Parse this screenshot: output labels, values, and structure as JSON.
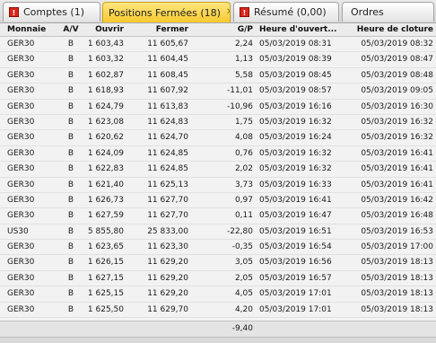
{
  "tabs": [
    {
      "label": "Comptes (1)",
      "alert": "!",
      "active": false
    },
    {
      "label": "Positions Fermées (18)",
      "close": "✕",
      "active": true
    },
    {
      "label": "Résumé (0,00)",
      "alert": "!",
      "active": false
    },
    {
      "label": "Ordres",
      "active": false
    }
  ],
  "columns": {
    "monnaie": "Monnaie",
    "av": "A/V",
    "ouvrir": "Ouvrir",
    "fermer": "Fermer",
    "gp": "G/P",
    "heure_ouverture": "Heure d'ouvert...",
    "heure_cloture": "Heure de cloture"
  },
  "rows": [
    {
      "monnaie": "GER30",
      "av": "B",
      "ouvrir": "1 603,43",
      "fermer": "11 605,67",
      "gp": "2,24",
      "heure_ouverture": "05/03/2019 08:31",
      "heure_cloture": "05/03/2019 08:32"
    },
    {
      "monnaie": "GER30",
      "av": "B",
      "ouvrir": "1 603,32",
      "fermer": "11 604,45",
      "gp": "1,13",
      "heure_ouverture": "05/03/2019 08:39",
      "heure_cloture": "05/03/2019 08:47"
    },
    {
      "monnaie": "GER30",
      "av": "B",
      "ouvrir": "1 602,87",
      "fermer": "11 608,45",
      "gp": "5,58",
      "heure_ouverture": "05/03/2019 08:45",
      "heure_cloture": "05/03/2019 08:48"
    },
    {
      "monnaie": "GER30",
      "av": "B",
      "ouvrir": "1 618,93",
      "fermer": "11 607,92",
      "gp": "-11,01",
      "heure_ouverture": "05/03/2019 08:57",
      "heure_cloture": "05/03/2019 09:05"
    },
    {
      "monnaie": "GER30",
      "av": "B",
      "ouvrir": "1 624,79",
      "fermer": "11 613,83",
      "gp": "-10,96",
      "heure_ouverture": "05/03/2019 16:16",
      "heure_cloture": "05/03/2019 16:30"
    },
    {
      "monnaie": "GER30",
      "av": "B",
      "ouvrir": "1 623,08",
      "fermer": "11 624,83",
      "gp": "1,75",
      "heure_ouverture": "05/03/2019 16:32",
      "heure_cloture": "05/03/2019 16:32"
    },
    {
      "monnaie": "GER30",
      "av": "B",
      "ouvrir": "1 620,62",
      "fermer": "11 624,70",
      "gp": "4,08",
      "heure_ouverture": "05/03/2019 16:24",
      "heure_cloture": "05/03/2019 16:32"
    },
    {
      "monnaie": "GER30",
      "av": "B",
      "ouvrir": "1 624,09",
      "fermer": "11 624,85",
      "gp": "0,76",
      "heure_ouverture": "05/03/2019 16:32",
      "heure_cloture": "05/03/2019 16:41"
    },
    {
      "monnaie": "GER30",
      "av": "B",
      "ouvrir": "1 622,83",
      "fermer": "11 624,85",
      "gp": "2,02",
      "heure_ouverture": "05/03/2019 16:32",
      "heure_cloture": "05/03/2019 16:41"
    },
    {
      "monnaie": "GER30",
      "av": "B",
      "ouvrir": "1 621,40",
      "fermer": "11 625,13",
      "gp": "3,73",
      "heure_ouverture": "05/03/2019 16:33",
      "heure_cloture": "05/03/2019 16:41"
    },
    {
      "monnaie": "GER30",
      "av": "B",
      "ouvrir": "1 626,73",
      "fermer": "11 627,70",
      "gp": "0,97",
      "heure_ouverture": "05/03/2019 16:41",
      "heure_cloture": "05/03/2019 16:42"
    },
    {
      "monnaie": "GER30",
      "av": "B",
      "ouvrir": "1 627,59",
      "fermer": "11 627,70",
      "gp": "0,11",
      "heure_ouverture": "05/03/2019 16:47",
      "heure_cloture": "05/03/2019 16:48"
    },
    {
      "monnaie": "US30",
      "av": "B",
      "ouvrir": "5 855,80",
      "fermer": "25 833,00",
      "gp": "-22,80",
      "heure_ouverture": "05/03/2019 16:51",
      "heure_cloture": "05/03/2019 16:53"
    },
    {
      "monnaie": "GER30",
      "av": "B",
      "ouvrir": "1 623,65",
      "fermer": "11 623,30",
      "gp": "-0,35",
      "heure_ouverture": "05/03/2019 16:54",
      "heure_cloture": "05/03/2019 17:00"
    },
    {
      "monnaie": "GER30",
      "av": "B",
      "ouvrir": "1 626,15",
      "fermer": "11 629,20",
      "gp": "3,05",
      "heure_ouverture": "05/03/2019 16:56",
      "heure_cloture": "05/03/2019 18:13"
    },
    {
      "monnaie": "GER30",
      "av": "B",
      "ouvrir": "1 627,15",
      "fermer": "11 629,20",
      "gp": "2,05",
      "heure_ouverture": "05/03/2019 16:57",
      "heure_cloture": "05/03/2019 18:13"
    },
    {
      "monnaie": "GER30",
      "av": "B",
      "ouvrir": "1 625,15",
      "fermer": "11 629,20",
      "gp": "4,05",
      "heure_ouverture": "05/03/2019 17:01",
      "heure_cloture": "05/03/2019 18:13"
    },
    {
      "monnaie": "GER30",
      "av": "B",
      "ouvrir": "1 625,50",
      "fermer": "11 629,70",
      "gp": "4,20",
      "heure_ouverture": "05/03/2019 17:01",
      "heure_cloture": "05/03/2019 18:13"
    }
  ],
  "footer": {
    "total_gp": "-9,40"
  },
  "colors": {
    "active_tab": "#f7c92e",
    "alert": "#d9261c"
  }
}
